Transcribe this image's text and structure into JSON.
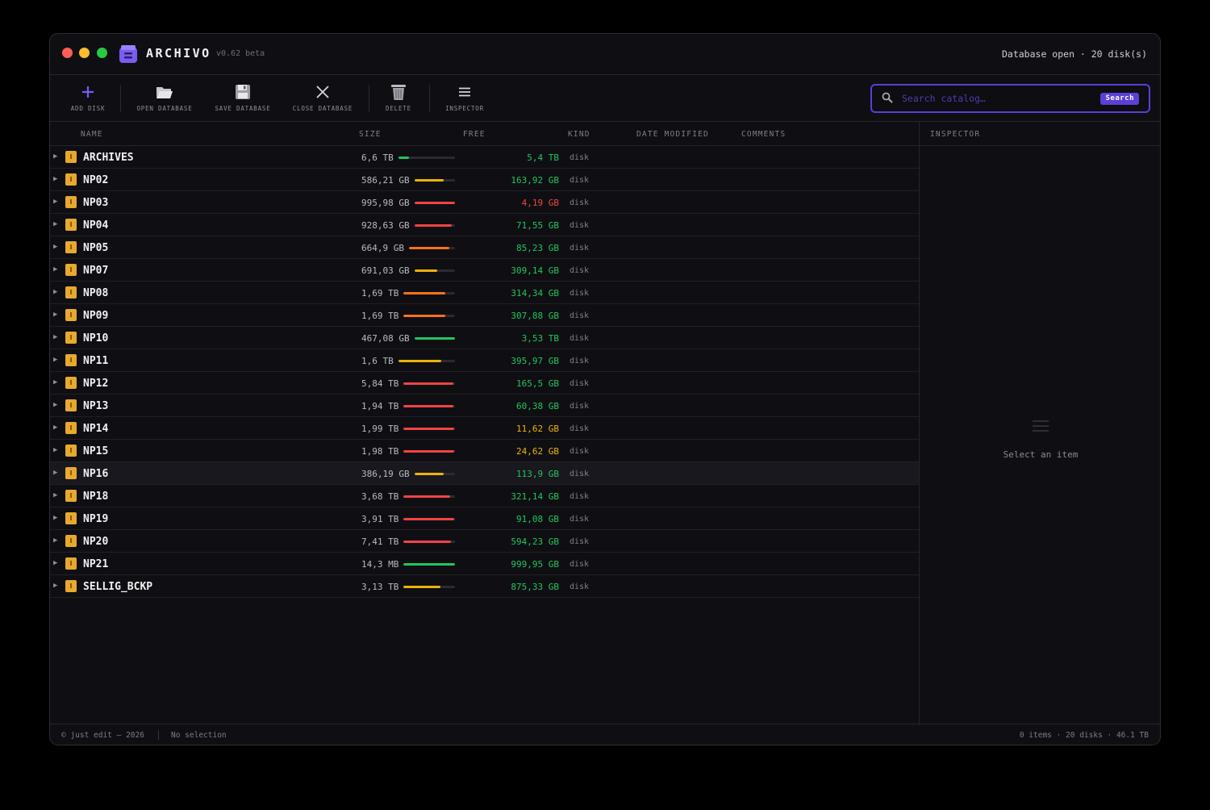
{
  "app": {
    "title": "ARCHIVO",
    "version": "v0.62 beta",
    "status": "Database open · 20 disk(s)",
    "brand_color": "#7b5cf0"
  },
  "toolbar": {
    "buttons": [
      {
        "label": "ADD DISK",
        "icon": "plus-icon"
      },
      {
        "label": "OPEN DATABASE",
        "icon": "folder-open-icon"
      },
      {
        "label": "SAVE DATABASE",
        "icon": "floppy-disk-icon"
      },
      {
        "label": "CLOSE DATABASE",
        "icon": "close-icon"
      },
      {
        "label": "DELETE",
        "icon": "trash-icon"
      },
      {
        "label": "INSPECTOR",
        "icon": "menu-lines-icon"
      }
    ],
    "search": {
      "placeholder": "Search catalog…",
      "value": "",
      "button_label": "Search"
    }
  },
  "table": {
    "headers": {
      "name": "NAME",
      "size": "SIZE",
      "free": "FREE",
      "kind": "KIND",
      "date_modified": "DATE MODIFIED",
      "comments": "COMMENTS"
    },
    "rows": [
      {
        "name": "ARCHIVES",
        "size": "6,6 TB",
        "used_fraction": 0.18,
        "bar_color": "#22c55e",
        "free": "5,4 TB",
        "free_color": "#22c55e",
        "kind": "disk"
      },
      {
        "name": "NP02",
        "size": "586,21 GB",
        "used_fraction": 0.72,
        "bar_color": "#eab308",
        "free": "163,92 GB",
        "free_color": "#22c55e",
        "kind": "disk"
      },
      {
        "name": "NP03",
        "size": "995,98 GB",
        "used_fraction": 1.0,
        "bar_color": "#ef4444",
        "free": "4,19 GB",
        "free_color": "#ef4444",
        "kind": "disk"
      },
      {
        "name": "NP04",
        "size": "928,63 GB",
        "used_fraction": 0.92,
        "bar_color": "#ef4444",
        "free": "71,55 GB",
        "free_color": "#22c55e",
        "kind": "disk"
      },
      {
        "name": "NP05",
        "size": "664,9 GB",
        "used_fraction": 0.87,
        "bar_color": "#f97316",
        "free": "85,23 GB",
        "free_color": "#22c55e",
        "kind": "disk"
      },
      {
        "name": "NP07",
        "size": "691,03 GB",
        "used_fraction": 0.55,
        "bar_color": "#eab308",
        "free": "309,14 GB",
        "free_color": "#22c55e",
        "kind": "disk"
      },
      {
        "name": "NP08",
        "size": "1,69 TB",
        "used_fraction": 0.81,
        "bar_color": "#f97316",
        "free": "314,34 GB",
        "free_color": "#22c55e",
        "kind": "disk"
      },
      {
        "name": "NP09",
        "size": "1,69 TB",
        "used_fraction": 0.82,
        "bar_color": "#f97316",
        "free": "307,88 GB",
        "free_color": "#22c55e",
        "kind": "disk"
      },
      {
        "name": "NP10",
        "size": "467,08 GB",
        "used_fraction": 1.0,
        "bar_color": "#22c55e",
        "free": "3,53 TB",
        "free_color": "#22c55e",
        "kind": "disk"
      },
      {
        "name": "NP11",
        "size": "1,6 TB",
        "used_fraction": 0.76,
        "bar_color": "#eab308",
        "free": "395,97 GB",
        "free_color": "#22c55e",
        "kind": "disk"
      },
      {
        "name": "NP12",
        "size": "5,84 TB",
        "used_fraction": 0.97,
        "bar_color": "#ef4444",
        "free": "165,5 GB",
        "free_color": "#22c55e",
        "kind": "disk"
      },
      {
        "name": "NP13",
        "size": "1,94 TB",
        "used_fraction": 0.97,
        "bar_color": "#ef4444",
        "free": "60,38 GB",
        "free_color": "#22c55e",
        "kind": "disk"
      },
      {
        "name": "NP14",
        "size": "1,99 TB",
        "used_fraction": 0.99,
        "bar_color": "#ef4444",
        "free": "11,62 GB",
        "free_color": "#eab308",
        "kind": "disk"
      },
      {
        "name": "NP15",
        "size": "1,98 TB",
        "used_fraction": 0.99,
        "bar_color": "#ef4444",
        "free": "24,62 GB",
        "free_color": "#eab308",
        "kind": "disk"
      },
      {
        "name": "NP16",
        "size": "386,19 GB",
        "used_fraction": 0.71,
        "bar_color": "#eab308",
        "free": "113,9 GB",
        "free_color": "#22c55e",
        "kind": "disk"
      },
      {
        "name": "NP18",
        "size": "3,68 TB",
        "used_fraction": 0.91,
        "bar_color": "#ef4444",
        "free": "321,14 GB",
        "free_color": "#22c55e",
        "kind": "disk"
      },
      {
        "name": "NP19",
        "size": "3,91 TB",
        "used_fraction": 0.98,
        "bar_color": "#ef4444",
        "free": "91,08 GB",
        "free_color": "#22c55e",
        "kind": "disk"
      },
      {
        "name": "NP20",
        "size": "7,41 TB",
        "used_fraction": 0.92,
        "bar_color": "#ef4444",
        "free": "594,23 GB",
        "free_color": "#22c55e",
        "kind": "disk"
      },
      {
        "name": "NP21",
        "size": "14,3 MB",
        "used_fraction": 1.0,
        "bar_color": "#22c55e",
        "free": "999,95 GB",
        "free_color": "#22c55e",
        "kind": "disk"
      },
      {
        "name": "SELLIG_BCKP",
        "size": "3,13 TB",
        "used_fraction": 0.72,
        "bar_color": "#eab308",
        "free": "875,33 GB",
        "free_color": "#22c55e",
        "kind": "disk"
      }
    ]
  },
  "inspector": {
    "title": "INSPECTOR",
    "empty_text": "Select an item"
  },
  "statusbar": {
    "copyright": "© just edit — 2026",
    "selection": "No selection",
    "summary": "0 items · 20 disks · 46.1 TB"
  }
}
